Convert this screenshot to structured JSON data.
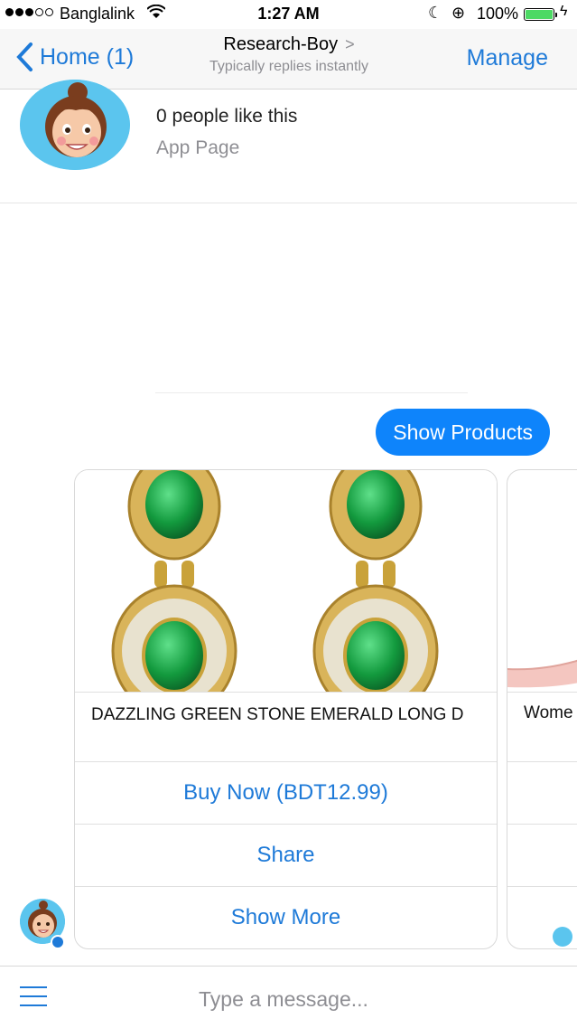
{
  "status_bar": {
    "carrier": "Banglalink",
    "time": "1:27 AM",
    "battery": "100%"
  },
  "nav": {
    "back_label": "Home (1)",
    "title": "Research-Boy",
    "subtitle": "Typically replies instantly",
    "manage_label": "Manage"
  },
  "page_info": {
    "likes": "0 people like this",
    "type": "App Page"
  },
  "messages": {
    "sent_bubble": "Show Products"
  },
  "product_card": {
    "title": "DAZZLING GREEN STONE EMERALD LONG D",
    "buttons": [
      "Buy Now (BDT12.99)",
      "Share",
      "Show More"
    ]
  },
  "product_card_2": {
    "title": "Wome"
  },
  "composer": {
    "placeholder": "Type a message..."
  },
  "colors": {
    "accent": "#1e7ad8",
    "bubble": "#0e84fb",
    "avatar_bg": "#5bc5ee",
    "emerald": "#1aa34a",
    "gold": "#c9a23a"
  }
}
